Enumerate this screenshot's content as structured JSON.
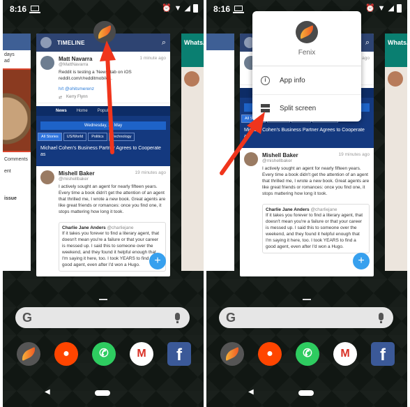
{
  "status": {
    "time": "8:16"
  },
  "timeline": {
    "title": "TIMELINE",
    "tweets": [
      {
        "name": "Matt Navarra",
        "handle": "@MattNavarra",
        "time": "1 minute ago",
        "text": "Reddit is testing a 'News' tab on iOS reddit.com/r/redditmobile...",
        "hat_tip": "h/t @ohitsmerenz",
        "retweet": "Kerry Flynn"
      },
      {
        "name": "Mishell Baker",
        "handle": "@mishellbaker",
        "time": "19 minutes ago",
        "text": "I actively sought an agent for nearly fifteen years. Every time a book didn't get the attention of an agent that thrilled me, I wrote a new book. Great agents are like great friends or romances: once you find one, it stops mattering how long it took.",
        "quote_name": "Charlie Jane Anders",
        "quote_handle": "@charliejane",
        "quote_text": "If it takes you forever to find a literary agent, that doesn't mean you're a failure or that your career is messed up. I said this to someone over the weekend, and they found it helpful enough that I'm saying it here, too. I took YEARS to find a good agent, even after I'd won a Hugo."
      }
    ],
    "news": {
      "nav": [
        "News",
        "Home",
        "Popular"
      ],
      "date": "Wednesday, 23 May",
      "tabs": [
        "All Stories",
        "US/World",
        "Politics",
        "Technology"
      ],
      "headline": "Michael Cohen's Business Partner Agrees to Cooperate as"
    }
  },
  "left_card": {
    "lines": [
      "days",
      "ad",
      "Comments",
      "ent",
      "issue"
    ]
  },
  "right_card": {
    "title": "WhatsA"
  },
  "popup": {
    "app_name": "Fenix",
    "items": [
      {
        "label": "App info",
        "icon": "info-icon"
      },
      {
        "label": "Split screen",
        "icon": "split-screen-icon"
      }
    ]
  },
  "dock": [
    "Fenix",
    "Reddit",
    "WhatsApp",
    "Gmail",
    "Facebook"
  ],
  "search": {
    "logo": "G"
  },
  "colors": {
    "arrow": "#f0351c",
    "header": "#2e4472",
    "fab": "#37a0ee"
  }
}
